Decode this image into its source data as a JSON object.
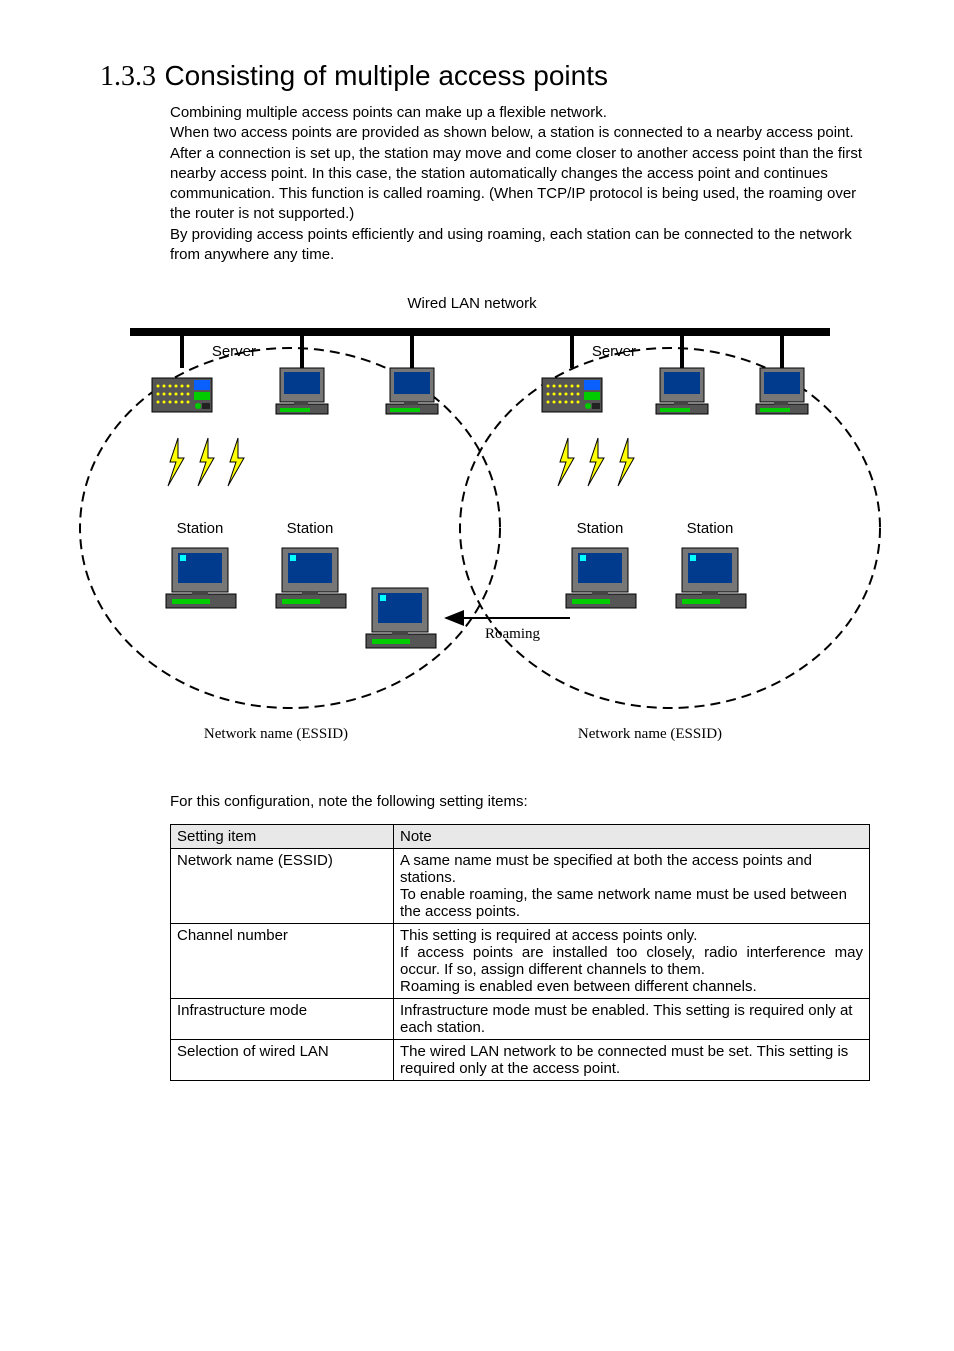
{
  "section": {
    "number": "1.3.3",
    "title": "Consisting of multiple access points"
  },
  "paragraph1": "Combining multiple access points can make up a flexible network.",
  "paragraph2": "When two access points are provided as shown below, a station is connected to a nearby access point.   After a connection is set up, the station may move and come closer to another access point than the first nearby access point.   In this case, the station automatically changes the access point and continues communication.   This function is called roaming. (When TCP/IP protocol is being used, the roaming over the router is not supported.)",
  "paragraph3": "By providing access points efficiently and using roaming, each station can be connected to the network from anywhere any time.",
  "diagram": {
    "title": "Wired LAN network",
    "server1": "Server",
    "server2": "Server",
    "station1": "Station",
    "station2": "Station",
    "station3": "Station",
    "station4": "Station",
    "roaming": "Roaming",
    "essid1": "Network name (ESSID)",
    "essid2": "Network name (ESSID)"
  },
  "note_line": "For this configuration, note the following setting items:",
  "table": {
    "headers": {
      "item": "Setting item",
      "note": "Note"
    },
    "rows": [
      {
        "item": "Network name (ESSID)",
        "note_l1": "A same name must be specified at both the access points and stations.",
        "note_l2": "To enable roaming, the same network name must be used between the access points."
      },
      {
        "item": "Channel number",
        "note_l1": "This setting is required at access points only.",
        "note_l2": "If access points are installed too closely, radio interference may occur.  If so, assign different channels to them.",
        "note_l3": "Roaming is enabled even between different channels."
      },
      {
        "item": "Infrastructure mode",
        "note": "Infrastructure mode must be enabled.  This setting is required only at each station."
      },
      {
        "item": "Selection of wired LAN",
        "note": "The wired LAN network to be connected must be set.  This setting is required only at the access point."
      }
    ]
  }
}
